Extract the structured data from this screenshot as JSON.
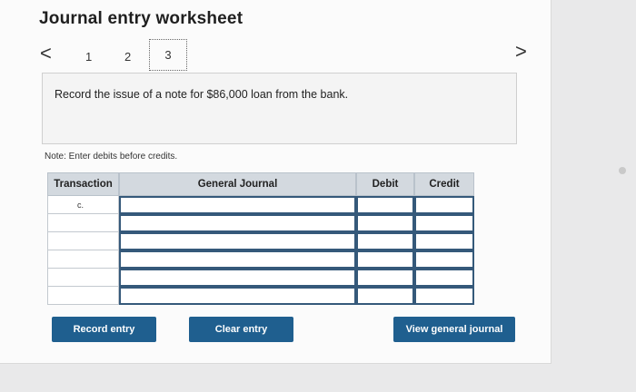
{
  "title": "Journal entry worksheet",
  "nav": {
    "prev_icon": "chevron-left-icon",
    "next_icon": "chevron-right-icon",
    "prev": "<",
    "next": ">",
    "steps": [
      "1",
      "2",
      "3"
    ],
    "current_step": "3"
  },
  "prompt": "Record the issue of a note for $86,000 loan from the bank.",
  "note": "Note: Enter debits before credits.",
  "table": {
    "headers": {
      "transaction": "Transaction",
      "general_journal": "General Journal",
      "debit": "Debit",
      "credit": "Credit"
    },
    "rows": [
      {
        "transaction": "c.",
        "general_journal": "",
        "debit": "",
        "credit": ""
      },
      {
        "transaction": "",
        "general_journal": "",
        "debit": "",
        "credit": ""
      },
      {
        "transaction": "",
        "general_journal": "",
        "debit": "",
        "credit": ""
      },
      {
        "transaction": "",
        "general_journal": "",
        "debit": "",
        "credit": ""
      },
      {
        "transaction": "",
        "general_journal": "",
        "debit": "",
        "credit": ""
      },
      {
        "transaction": "",
        "general_journal": "",
        "debit": "",
        "credit": ""
      }
    ]
  },
  "buttons": {
    "record": "Record entry",
    "clear": "Clear entry",
    "view": "View general journal"
  },
  "colors": {
    "button_bg": "#1f5f8f",
    "header_bg": "#d3d9df",
    "input_border": "#35597a"
  }
}
